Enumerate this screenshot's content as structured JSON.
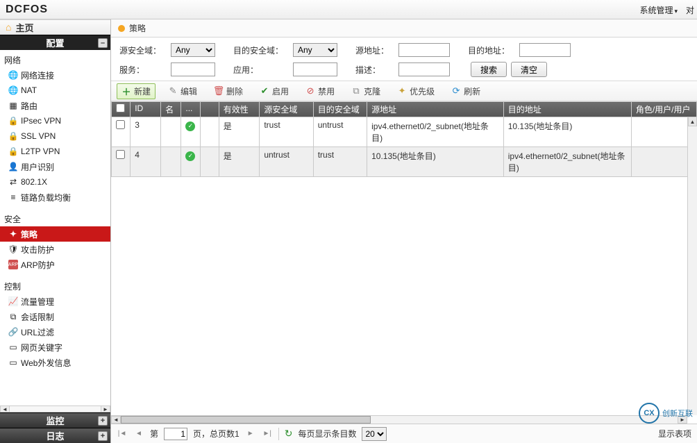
{
  "brand": "DCFOS",
  "top_menu": {
    "sys": "系统管理",
    "obj_cut": "对"
  },
  "sidebar": {
    "home": "主页",
    "config": "配置",
    "monitor": "监控",
    "log": "日志",
    "groups": [
      {
        "title": "网络",
        "items": [
          {
            "label": "网络连接",
            "icon": "🌐"
          },
          {
            "label": "NAT",
            "icon": "🌐"
          },
          {
            "label": "路由",
            "icon": "▦"
          },
          {
            "label": "IPsec VPN",
            "icon": "🔒"
          },
          {
            "label": "SSL VPN",
            "icon": "🔒"
          },
          {
            "label": "L2TP VPN",
            "icon": "🔒"
          },
          {
            "label": "用户识别",
            "icon": "👤"
          },
          {
            "label": "802.1X",
            "icon": "⇄"
          },
          {
            "label": "链路负载均衡",
            "icon": "≡"
          }
        ]
      },
      {
        "title": "安全",
        "items": [
          {
            "label": "策略",
            "icon": "✦",
            "active": true
          },
          {
            "label": "攻击防护",
            "icon": "🛡"
          },
          {
            "label": "ARP防护",
            "icon": "ARP"
          }
        ]
      },
      {
        "title": "控制",
        "items": [
          {
            "label": "流量管理",
            "icon": "📈"
          },
          {
            "label": "会话限制",
            "icon": "⧉"
          },
          {
            "label": "URL过滤",
            "icon": "🔗"
          },
          {
            "label": "网页关键字",
            "icon": "▭"
          },
          {
            "label": "Web外发信息",
            "icon": "▭"
          }
        ]
      }
    ]
  },
  "crumb": "策略",
  "filters": {
    "src_zone": "源安全域：",
    "src_zone_val": "Any",
    "dst_zone": "目的安全域：",
    "dst_zone_val": "Any",
    "src_addr": "源地址：",
    "dst_addr": "目的地址：",
    "service": "服务：",
    "app": "应用：",
    "desc": "描述：",
    "search": "搜索",
    "clear": "清空"
  },
  "toolbar": {
    "new": "新建",
    "edit": "编辑",
    "delete": "删除",
    "enable": "启用",
    "disable": "禁用",
    "clone": "克隆",
    "priority": "优先级",
    "refresh": "刷新"
  },
  "grid": {
    "headers": {
      "id": "ID",
      "name": "名",
      "dots": "...",
      "valid": "有效性",
      "srczone": "源安全域",
      "dstzone": "目的安全域",
      "saddr": "源地址",
      "daddr": "目的地址",
      "role": "角色/用户/用户"
    },
    "rows": [
      {
        "id": "3",
        "valid": "是",
        "srczone": "trust",
        "dstzone": "untrust",
        "saddr": "ipv4.ethernet0/2_subnet(地址条目)",
        "daddr": "10.135(地址条目)"
      },
      {
        "id": "4",
        "valid": "是",
        "srczone": "untrust",
        "dstzone": "trust",
        "saddr": "10.135(地址条目)",
        "daddr": "ipv4.ethernet0/2_subnet(地址条目)"
      }
    ]
  },
  "pager": {
    "page_prefix": "第",
    "page_val": "1",
    "page_suffix": "页，总页数1",
    "per_page_label": "每页显示条目数",
    "per_page_val": "20",
    "showing": "显示表项"
  },
  "watermark": {
    "logo": "CX",
    "text": "创新互联"
  }
}
